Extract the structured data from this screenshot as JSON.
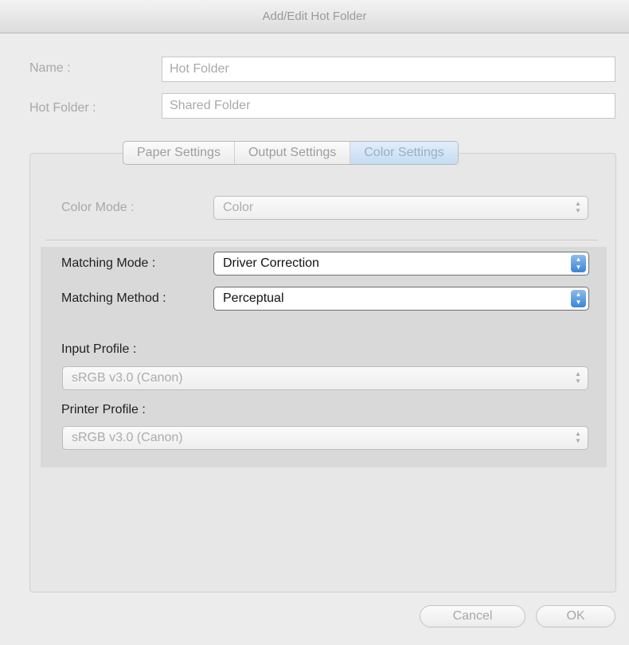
{
  "window": {
    "title": "Add/Edit Hot Folder"
  },
  "form": {
    "name_label": "Name :",
    "name_value": "Hot Folder",
    "hotfolder_label": "Hot Folder :",
    "hotfolder_value": "Shared Folder"
  },
  "tabs": [
    {
      "label": "Paper Settings",
      "active": false
    },
    {
      "label": "Output Settings",
      "active": false
    },
    {
      "label": "Color Settings",
      "active": true
    }
  ],
  "color_settings": {
    "color_mode_label": "Color Mode :",
    "color_mode_value": "Color",
    "matching_mode_label": "Matching Mode :",
    "matching_mode_value": "Driver Correction",
    "matching_method_label": "Matching Method :",
    "matching_method_value": "Perceptual",
    "input_profile_label": "Input Profile :",
    "input_profile_value": "sRGB v3.0 (Canon)",
    "printer_profile_label": "Printer Profile :",
    "printer_profile_value": "sRGB v3.0 (Canon)"
  },
  "buttons": {
    "cancel": "Cancel",
    "ok": "OK"
  },
  "icons": {
    "popup_arrows": "up-down-arrows-icon"
  },
  "colors": {
    "accent": "#3a85d8",
    "tab_active": "#c6dcf3"
  }
}
